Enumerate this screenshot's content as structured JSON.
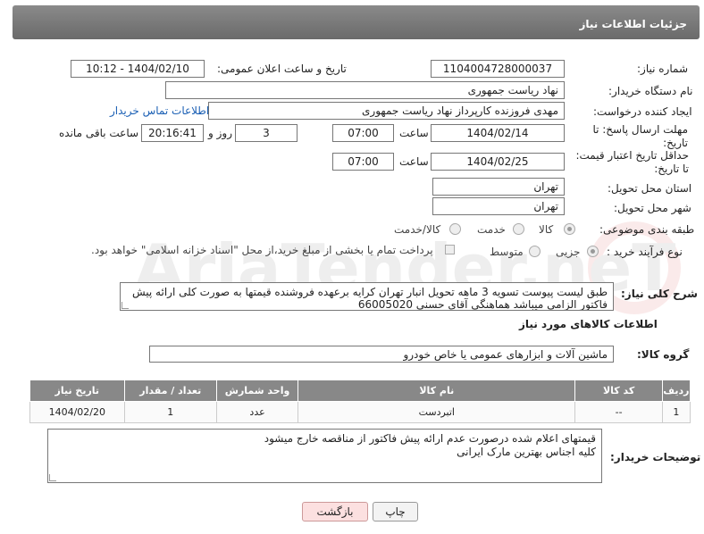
{
  "header": {
    "title": "جزئیات اطلاعات نیاز"
  },
  "fields": {
    "need_number_label": "شماره نیاز:",
    "need_number": "1104004728000037",
    "announce_label": "تاریخ و ساعت اعلان عمومی:",
    "announce_value": "1404/02/10 - 10:12",
    "buyer_org_label": "نام دستگاه خریدار:",
    "buyer_org": "نهاد ریاست جمهوری",
    "requester_label": "ایجاد کننده درخواست:",
    "requester": "مهدی فروزنده کارپرداز نهاد ریاست جمهوری",
    "contact_link": "اطلاعات تماس خریدار",
    "deadline_label": "مهلت ارسال پاسخ: تا تاریخ:",
    "deadline_date": "1404/02/14",
    "time_label": "ساعت",
    "deadline_time": "07:00",
    "days_value": "3",
    "days_label": "روز و",
    "remaining_time": "20:16:41",
    "remaining_label": "ساعت باقی مانده",
    "min_validity_label": "حداقل تاریخ اعتبار قیمت: تا تاریخ:",
    "validity_date": "1404/02/25",
    "validity_time": "07:00",
    "province_label": "استان محل تحویل:",
    "province": "تهران",
    "city_label": "شهر محل تحویل:",
    "city": "تهران",
    "category_label": "طبقه بندی موضوعی:",
    "category_options": [
      "کالا",
      "خدمت",
      "کالا/خدمت"
    ],
    "process_label": "نوع فرآیند خرید :",
    "process_options": [
      "جزیی",
      "متوسط"
    ],
    "payment_note": "پرداخت تمام یا بخشی از مبلغ خرید،از محل \"اسناد خزانه اسلامی\" خواهد بود."
  },
  "description": {
    "label": "شرح کلی نیاز:",
    "text": "طبق لیست پیوست تسویه 3 ماهه تحویل انبار تهران کرایه برعهده فروشنده قیمتها به صورت کلی ارائه پیش فاکتور الزامی میباشد هماهنگی آقای حسنی 66005020"
  },
  "goods_info": {
    "title": "اطلاعات کالاهای مورد نیاز",
    "group_label": "گروه کالا:",
    "group_value": "ماشین آلات و ابزارهای عمومی یا خاص خودرو"
  },
  "table": {
    "headers": [
      "ردیف",
      "کد کالا",
      "نام کالا",
      "واحد شمارش",
      "تعداد / مقدار",
      "تاریخ نیاز"
    ],
    "rows": [
      [
        "1",
        "--",
        "اتبردست",
        "عدد",
        "1",
        "1404/02/20"
      ]
    ]
  },
  "buyer_notes": {
    "label": "توضیحات خریدار:",
    "line1": "قیمتهای اعلام شده درصورت عدم ارائه پیش فاکتور از مناقصه خارج میشود",
    "line2": "کلیه اجناس بهترین مارک ایرانی"
  },
  "buttons": {
    "print": "چاپ",
    "back": "بازگشت"
  },
  "watermark": {
    "text": "AriaTender.neT"
  }
}
